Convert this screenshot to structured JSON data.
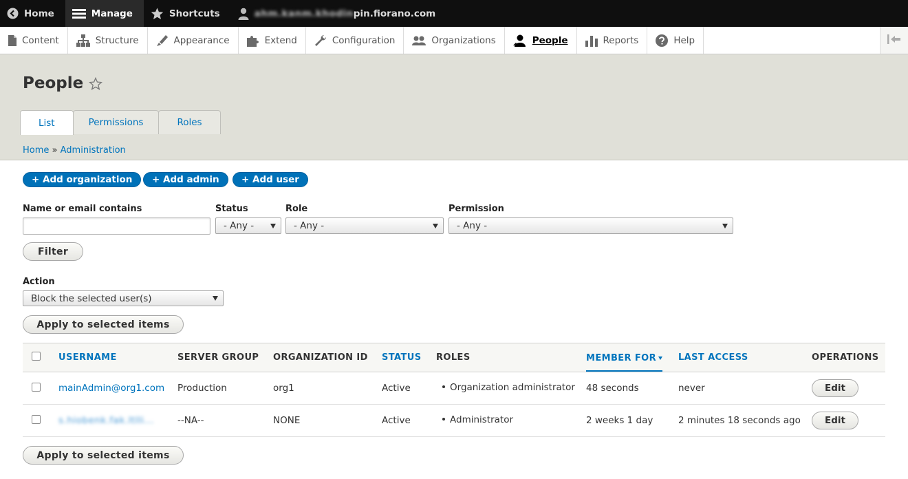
{
  "toolbar": {
    "home": "Home",
    "manage": "Manage",
    "shortcuts": "Shortcuts",
    "user": "ahm.kanm.khodinpin.fiorano.com"
  },
  "tray": {
    "items": [
      "Content",
      "Structure",
      "Appearance",
      "Extend",
      "Configuration",
      "Organizations",
      "People",
      "Reports",
      "Help"
    ]
  },
  "page": {
    "title": "People",
    "tabs": [
      "List",
      "Permissions",
      "Roles"
    ]
  },
  "breadcrumb": {
    "home": "Home",
    "separator": "»",
    "current": "Administration"
  },
  "actions": {
    "add_organization": "+ Add organization",
    "add_admin": "+ Add admin",
    "add_user": "+ Add user"
  },
  "filters": {
    "name_label": "Name or email contains",
    "name_value": "",
    "status_label": "Status",
    "status_value": "- Any -",
    "role_label": "Role",
    "role_value": "- Any -",
    "permission_label": "Permission",
    "permission_value": "- Any -",
    "filter_button": "Filter"
  },
  "bulk": {
    "action_label": "Action",
    "action_value": "Block the selected user(s)",
    "apply_button": "Apply to selected items"
  },
  "table": {
    "headers": {
      "username": "USERNAME",
      "server_group": "SERVER GROUP",
      "organization_id": "ORGANIZATION ID",
      "status": "STATUS",
      "roles": "ROLES",
      "member_for": "MEMBER FOR",
      "last_access": "LAST ACCESS",
      "operations": "OPERATIONS"
    },
    "rows": [
      {
        "username": "mainAdmin@org1.com",
        "server_group": "Production",
        "organization_id": "org1",
        "status": "Active",
        "role": "Organization administrator",
        "member_for": "48 seconds",
        "last_access": "never",
        "operation": "Edit"
      },
      {
        "username": "s.hiobenk.fak.ltlli...",
        "server_group": "--NA--",
        "organization_id": "NONE",
        "status": "Active",
        "role": "Administrator",
        "member_for": "2 weeks 1 day",
        "last_access": "2 minutes 18 seconds ago",
        "operation": "Edit"
      }
    ]
  },
  "colors": {
    "link": "#0074bd",
    "primary_button": "#0071b8",
    "toolbar_bg": "#0f0f0f",
    "header_bg": "#e0e0d8"
  }
}
